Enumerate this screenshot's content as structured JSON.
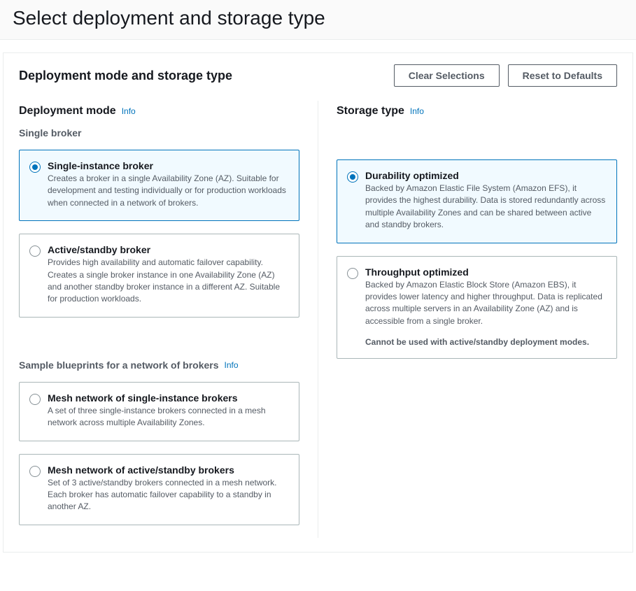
{
  "page": {
    "title": "Select deployment and storage type"
  },
  "panel": {
    "title": "Deployment mode and storage type",
    "clear_button": "Clear Selections",
    "reset_button": "Reset to Defaults"
  },
  "deployment": {
    "heading": "Deployment mode",
    "info": "Info",
    "single_broker_heading": "Single broker",
    "options": [
      {
        "title": "Single-instance broker",
        "desc": "Creates a broker in a single Availability Zone (AZ). Suitable for development and testing individually or for production workloads when connected in a network of brokers."
      },
      {
        "title": "Active/standby broker",
        "desc": "Provides high availability and automatic failover capability. Creates a single broker instance in one Availability Zone (AZ) and another standby broker instance in a different AZ. Suitable for production workloads."
      }
    ],
    "blueprints_heading": "Sample blueprints for a network of brokers",
    "blueprints_info": "Info",
    "blueprints": [
      {
        "title": "Mesh network of single-instance brokers",
        "desc": "A set of three single-instance brokers connected in a mesh network across multiple Availability Zones."
      },
      {
        "title": "Mesh network of active/standby brokers",
        "desc": "Set of 3 active/standby brokers connected in a mesh network. Each broker has automatic failover capability to a standby in another AZ."
      }
    ]
  },
  "storage": {
    "heading": "Storage type",
    "info": "Info",
    "options": [
      {
        "title": "Durability optimized",
        "desc": "Backed by Amazon Elastic File System (Amazon EFS), it provides the highest durability. Data is stored redundantly across multiple Availability Zones and can be shared between active and standby brokers."
      },
      {
        "title": "Throughput optimized",
        "desc": "Backed by Amazon Elastic Block Store (Amazon EBS), it provides lower latency and higher throughput. Data is replicated across multiple servers in an Availability Zone (AZ) and is accessible from a single broker.",
        "note": "Cannot be used with active/standby deployment modes."
      }
    ]
  }
}
